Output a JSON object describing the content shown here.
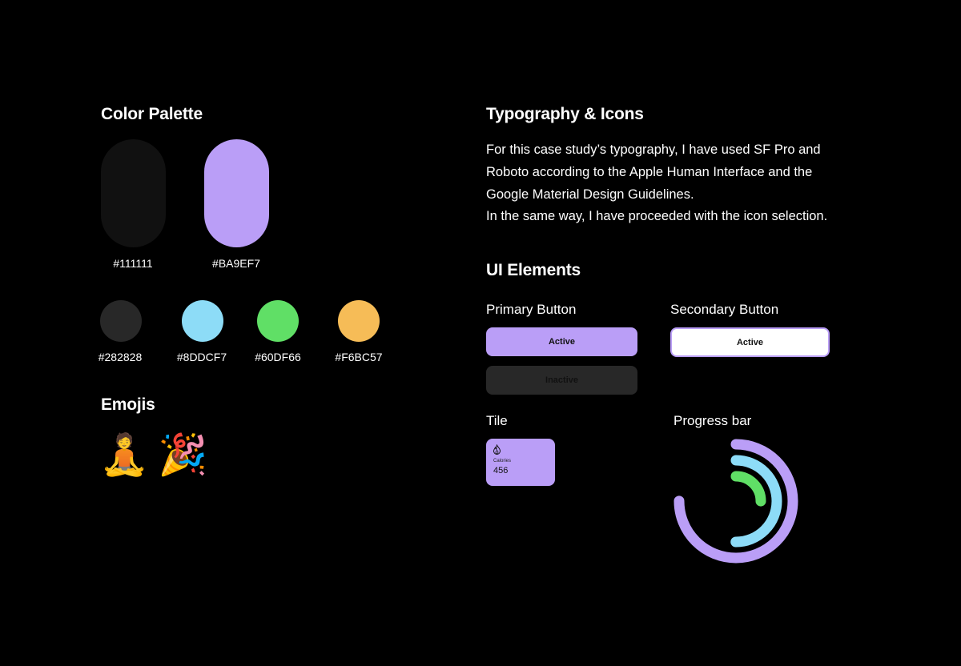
{
  "colors": {
    "title": "Color Palette",
    "large": [
      {
        "hex": "#111111",
        "label": "#111111"
      },
      {
        "hex": "#BA9EF7",
        "label": "#BA9EF7"
      }
    ],
    "small": [
      {
        "hex": "#282828",
        "label": "#282828"
      },
      {
        "hex": "#8DDCF7",
        "label": "#8DDCF7"
      },
      {
        "hex": "#60DF66",
        "label": "#60DF66"
      },
      {
        "hex": "#F6BC57",
        "label": "#F6BC57"
      }
    ]
  },
  "emojis": {
    "title": "Emojis",
    "items": [
      "🧘",
      "🎉"
    ]
  },
  "typography": {
    "title": "Typography & Icons",
    "lines": [
      "For this case study’s typography, I have used SF Pro and",
      "Roboto according to the Apple Human Interface and the",
      "Google Material Design Guidelines.",
      "In the same way, I have proceeded with the icon selection."
    ]
  },
  "ui_elements": {
    "title": "UI Elements",
    "primary": {
      "label": "Primary Button",
      "active": "Active",
      "inactive": "Inactive"
    },
    "secondary": {
      "label": "Secondary Button",
      "active": "Active"
    },
    "tile": {
      "label": "Tile",
      "icon": "flame-icon",
      "caption": "Calories",
      "value": "456"
    },
    "progress": {
      "label": "Progress bar",
      "rings": [
        {
          "color": "#BA9EF7",
          "value": 0.75
        },
        {
          "color": "#8DDCF7",
          "value": 0.5
        },
        {
          "color": "#60DF66",
          "value": 0.25
        }
      ]
    }
  }
}
